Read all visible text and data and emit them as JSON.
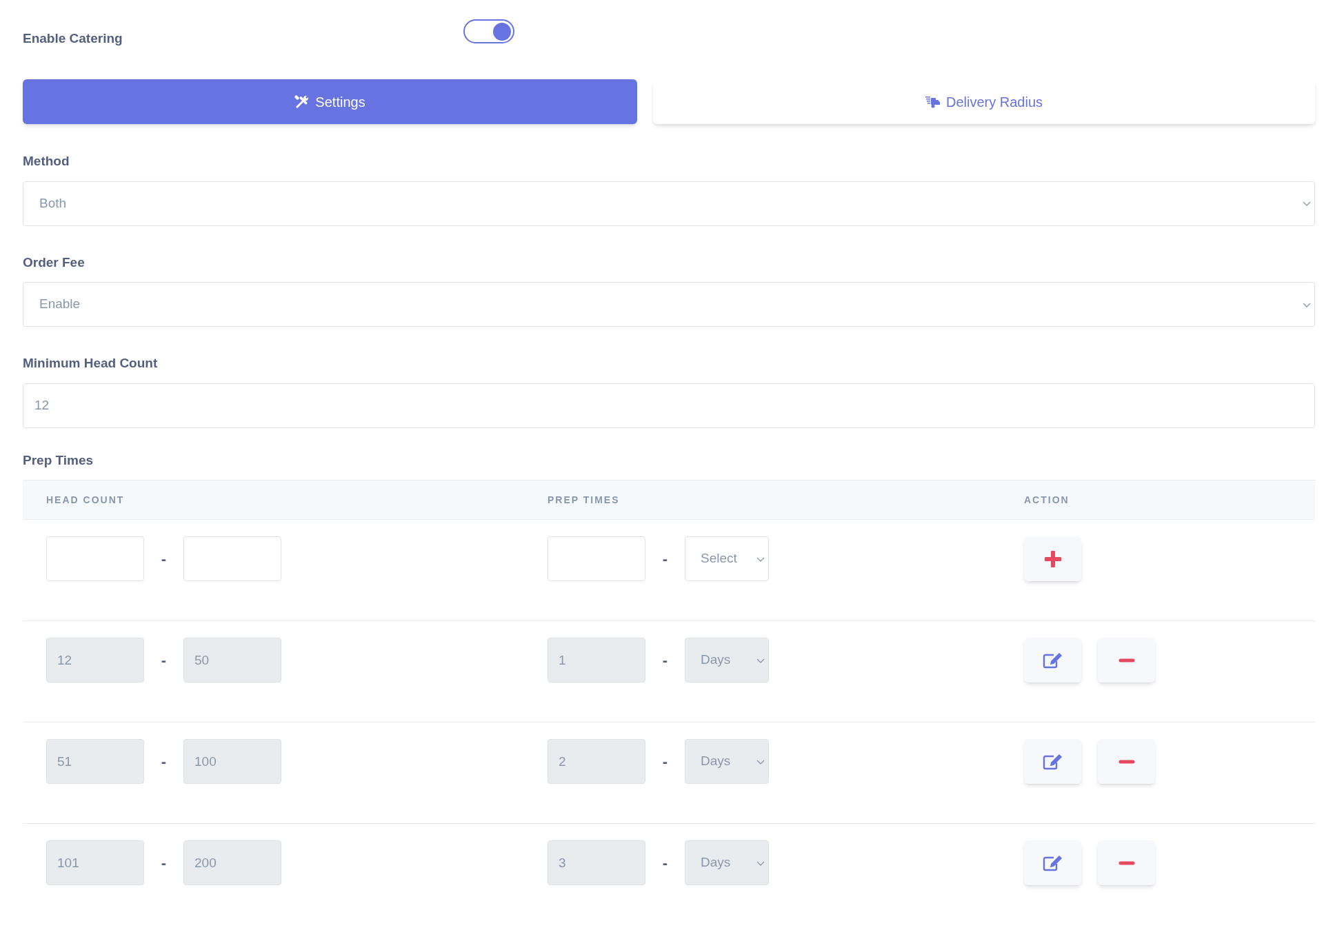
{
  "catering_toggle": {
    "label": "Enable Catering",
    "on": true
  },
  "tabs": [
    {
      "label": "Settings",
      "selected": true
    },
    {
      "label": "Delivery Radius",
      "selected": false
    }
  ],
  "fields": [
    {
      "kind": "select",
      "label": "Method",
      "value": "Both"
    },
    {
      "kind": "select",
      "label": "Order Fee",
      "value": "Enable"
    },
    {
      "kind": "input",
      "label": "Minimum Head Count",
      "value": "12"
    }
  ],
  "prep_times": {
    "label": "Prep Times",
    "columns": [
      "HEAD COUNT",
      "PREP TIMES",
      "ACTION"
    ],
    "separator": "-",
    "rows": [
      {
        "kind": "new",
        "unit": "Select",
        "disabled": false
      },
      {
        "kind": "saved",
        "head_from": "12",
        "head_to": "50",
        "time": "1",
        "unit": "Days",
        "disabled": true
      },
      {
        "kind": "saved",
        "head_from": "51",
        "head_to": "100",
        "time": "2",
        "unit": "Days",
        "disabled": true
      },
      {
        "kind": "saved",
        "head_from": "101",
        "head_to": "200",
        "time": "3",
        "unit": "Days",
        "disabled": true
      }
    ]
  }
}
